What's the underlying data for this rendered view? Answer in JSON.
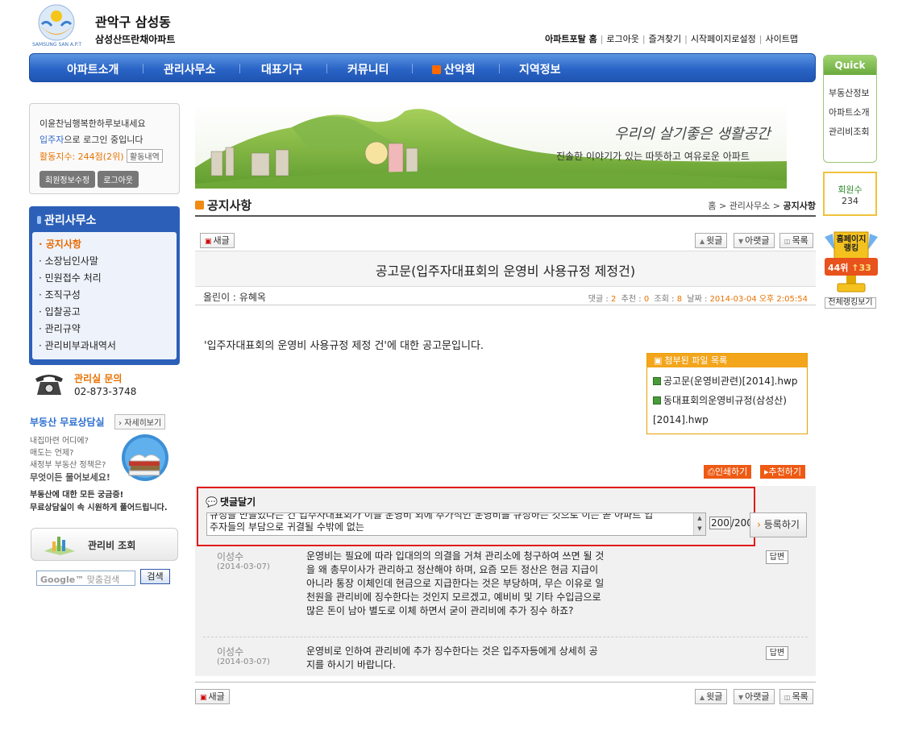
{
  "header": {
    "logo_title": "관악구 삼성동",
    "logo_subtitle": "삼성산뜨란채아파트",
    "logo_emblem_text": "SAMSUNG SAN A.P.T",
    "top_links": [
      "아파트포탈 홈",
      "로그아웃",
      "즐겨찾기",
      "시작페이지로설정",
      "사이트맵"
    ]
  },
  "nav": {
    "items": [
      "아파트소개",
      "관리사무소",
      "대표기구",
      "커뮤니티",
      "산악회",
      "지역정보"
    ]
  },
  "quick": {
    "title": "Quick",
    "items": [
      "부동산정보",
      "아파트소개",
      "관리비조회"
    ],
    "member_label": "회원수",
    "member_count": "234",
    "ranking_label": "홈페이지 랭킹",
    "rank": "44위",
    "rank_change": "↑33",
    "ranking_all": "전체랭킹보기"
  },
  "login": {
    "greeting": "이윤찬님행복한하루보내세요",
    "status_role": "입주자",
    "status_suffix": "으로 로그인 중입니다",
    "activity_label": "활동지수: 244점(2위)",
    "activity_btn": "활동내역",
    "btn_edit": "회원정보수정",
    "btn_logout": "로그아웃"
  },
  "sidebar": {
    "title": "관리사무소",
    "items": [
      "공지사항",
      "소장님인사말",
      "민원접수 처리",
      "조직구성",
      "입찰공고",
      "관리규약",
      "관리비부과내역서"
    ],
    "inquiry_title": "관리실 문의",
    "inquiry_phone": "02-873-3748",
    "realestate_title": "부동산 무료상담실",
    "realestate_more": "자세히보기",
    "realestate_lines": [
      "내집마련 어디에?",
      "매도는 언제?",
      "새정부 부동산 정책은?"
    ],
    "realestate_highlight": "무엇이든 물어보세요!",
    "realestate_bold1": "부동산에 대한 모든 궁금증!",
    "realestate_bold2": "무료상담실이 속 시원하게 풀어드립니다.",
    "fee_btn": "관리비 조회",
    "google_placeholder": "맞춤검색",
    "google_brand": "Google™",
    "google_btn": "검색"
  },
  "banner": {
    "slogan": "우리의 살기좋은 생활공간",
    "subtitle": "진솔한 이야기가 있는 따뜻하고 여유로운 아파트"
  },
  "page": {
    "title": "공지사항",
    "breadcrumb_home": "홈",
    "breadcrumb_mid": "관리사무소",
    "breadcrumb_current": "공지사항"
  },
  "toolbar": {
    "new": "새글",
    "prev": "윗글",
    "next": "아랫글",
    "list": "목록"
  },
  "post": {
    "title": "공고문(입주자대표회의 운영비 사용규정 제정건)",
    "author_label": "올린이 : 유혜옥",
    "comments_label": "댓글 :",
    "comments": "2",
    "recommend_label": "추천 :",
    "recommend": "0",
    "views_label": "조회 :",
    "views": "8",
    "date_label": "날짜 :",
    "date": "2014-03-04 오후 2:05:54",
    "body": "'입주자대표회의 운영비 사용규정 제정 건'에 대한 공고문입니다.",
    "attach_title": "첨부된 파일 목록",
    "attachments": [
      "공고문(운영비관련)[2014].hwp",
      "동대표회의운영비규정(삼성산)[2014].hwp"
    ],
    "print_btn": "인쇄하기",
    "recommend_btn": "추천하기"
  },
  "comment_form": {
    "title": "댓글달기",
    "line1": "규정을 만들었다는 건 입주자대표회가 이들 운영비 외에 추가적인 운영비를 규정하는 것으로 이는 곧 아파트 입",
    "line2": "주자들의 부담으로 귀결될 수밖에 없는",
    "count": "200",
    "max": "/200",
    "submit": "등록하기"
  },
  "comments": [
    {
      "name": "이성수",
      "date": "(2014-03-07)",
      "text": "운영비는 필요에 따라 입대의의 의결을 거쳐 관리소에 청구하여 쓰면 될 것을 왜 총무이사가 관리하고 정산해야 하며, 요즘 모든 정산은 현금 지급이 아니라 통장 이체인데 현금으로 지급한다는 것은 부당하며, 무슨 이유로 일천원을 관리비에 징수한다는 것인지 모르겠고, 예비비 및 기타 수입금으로 많은 돈이 남아 별도로 이체 하면서 굳이 관리비에 추가 징수 하죠?",
      "reply": "답변"
    },
    {
      "name": "이성수",
      "date": "(2014-03-07)",
      "text": "운영비로 인하여 관리비에 추가 징수한다는 것은 입주자등에게 상세히 공지를 하시기 바랍니다.",
      "reply": "답변"
    }
  ]
}
